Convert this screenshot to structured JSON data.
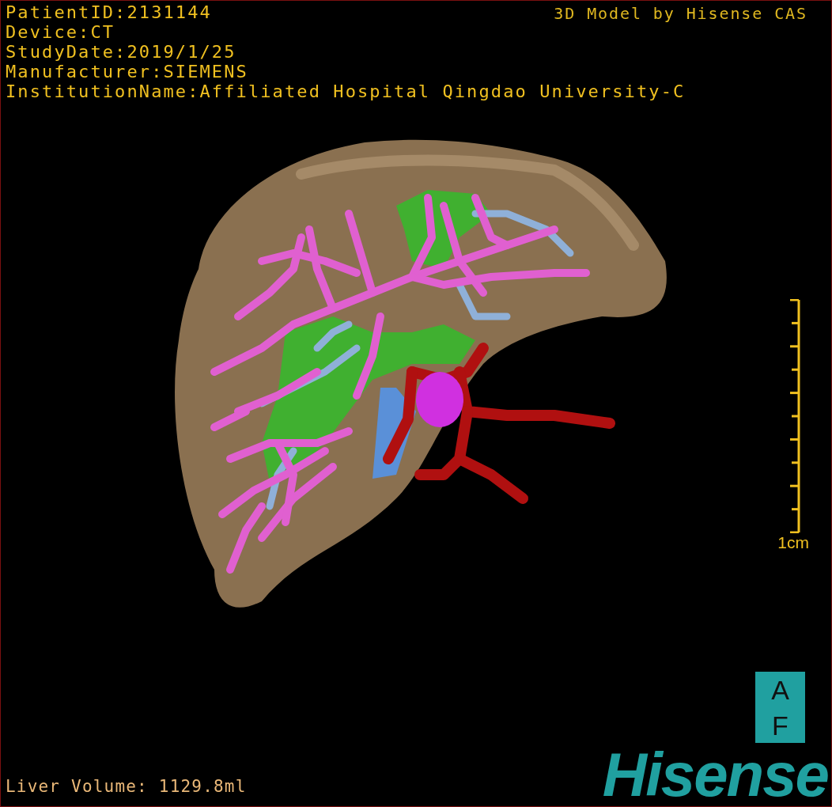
{
  "info_lines": [
    "PatientID:2131144",
    "Device:CT",
    "StudyDate:2019/1/25",
    "Manufacturer:SIEMENS",
    "InstitutionName:Affiliated Hospital Qingdao University-C"
  ],
  "title": "3D Model by Hisense CAS",
  "scale_bar": {
    "label": "1cm"
  },
  "orientation_cube": {
    "top": "A",
    "bottom": "F"
  },
  "liver_volume": "Liver Volume: 1129.8ml",
  "logo": "Hisense"
}
